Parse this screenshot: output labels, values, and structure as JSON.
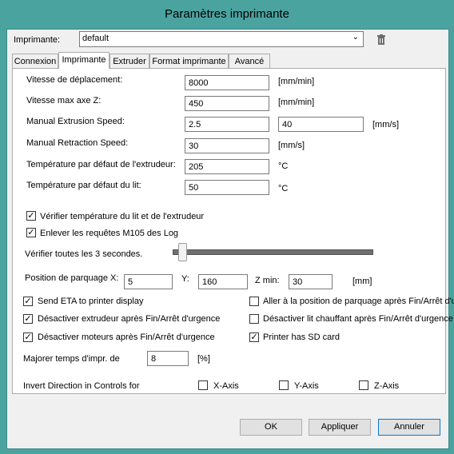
{
  "window": {
    "title": "Paramètres imprimante"
  },
  "printer": {
    "label": "Imprimante:",
    "selected": "default"
  },
  "tabs": [
    "Connexion",
    "Imprimante",
    "Extruder",
    "Format imprimante",
    "Avancé"
  ],
  "settings": {
    "travel_speed": {
      "label": "Vitesse de déplacement:",
      "value": "8000",
      "unit": "[mm/min]"
    },
    "max_z_speed": {
      "label": "Vitesse max axe Z:",
      "value": "450",
      "unit": "[mm/min]"
    },
    "manual_extrusion": {
      "label": "Manual Extrusion Speed:",
      "value1": "2.5",
      "value2": "40",
      "unit": "[mm/s]"
    },
    "manual_retraction": {
      "label": "Manual Retraction Speed:",
      "value": "30",
      "unit": "[mm/s]"
    },
    "extruder_temp": {
      "label": "Température par défaut de l'extrudeur:",
      "value": "205",
      "unit": "°C"
    },
    "bed_temp": {
      "label": "Température par défaut du lit:",
      "value": "50",
      "unit": "°C"
    }
  },
  "checks": {
    "verify_temp": {
      "label": "Vérifier température du lit et de l'extrudeur",
      "checked": true
    },
    "remove_m105": {
      "label": "Enlever les requêtes M105 des Log",
      "checked": true
    }
  },
  "verify_interval": {
    "label": "Vérifier toutes les 3 secondes.",
    "level": 0.05
  },
  "parking": {
    "label": "Position de parquage X:",
    "y_label": "Y:",
    "zmin_label": "Z min:",
    "x": "5",
    "y": "160",
    "zmin": "30",
    "unit": "[mm]"
  },
  "options": {
    "send_eta": {
      "label": "Send ETA to printer display",
      "checked": true
    },
    "goto_park": {
      "label": "Aller à la position de parquage après Fin/Arrêt d'u",
      "checked": false
    },
    "disable_extruder": {
      "label": "Désactiver extrudeur après Fin/Arrêt d'urgence",
      "checked": true
    },
    "disable_bed": {
      "label": "Désactiver lit chauffant après Fin/Arrêt d'urgence",
      "checked": false
    },
    "disable_motors": {
      "label": "Désactiver moteurs après Fin/Arrêt d'urgence",
      "checked": true
    },
    "sd_card": {
      "label": "Printer has SD card",
      "checked": true
    }
  },
  "time_factor": {
    "label": "Majorer temps d'impr. de",
    "value": "8",
    "unit": "[%]"
  },
  "invert": {
    "label": "Invert Direction in Controls for",
    "x": "X-Axis",
    "y": "Y-Axis",
    "z": "Z-Axis"
  },
  "buttons": {
    "ok": "OK",
    "apply": "Appliquer",
    "cancel": "Annuler"
  }
}
